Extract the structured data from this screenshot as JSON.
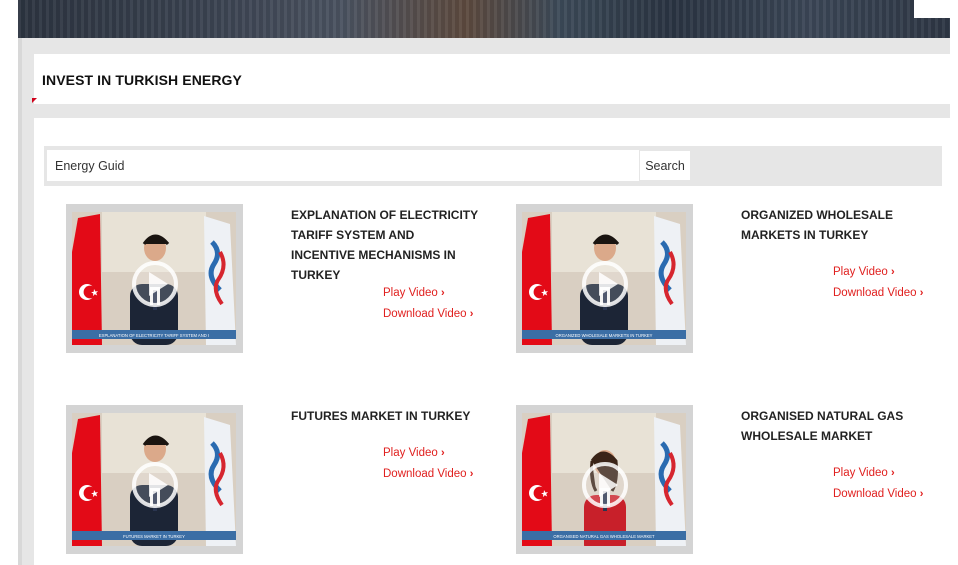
{
  "section": {
    "title": "INVEST IN TURKISH ENERGY"
  },
  "search": {
    "value": "Energy Guid",
    "button_label": "Search"
  },
  "videos": [
    {
      "title": "EXPLANATION OF ELECTRICITY TARIFF SYSTEM AND INCENTIVE MECHANISMS IN TURKEY",
      "play_label": "Play Video",
      "download_label": "Download Video",
      "caption": "EXPLANATION OF ELECTRICITY TARIFF SYSTEM AND INCENTIVE MECHANISMS IN TURKEY",
      "presenter": "man"
    },
    {
      "title": "ORGANIZED WHOLESALE MARKETS IN TURKEY",
      "play_label": "Play Video",
      "download_label": "Download Video",
      "caption": "ORGANIZED WHOLESALE MARKETS IN TURKEY",
      "presenter": "man"
    },
    {
      "title": "FUTURES MARKET IN TURKEY",
      "play_label": "Play Video",
      "download_label": "Download Video",
      "caption": "FUTURES MARKET IN TURKEY",
      "presenter": "man"
    },
    {
      "title": "ORGANISED NATURAL GAS WHOLESALE MARKET",
      "play_label": "Play Video",
      "download_label": "Download Video",
      "caption": "ORGANISED NATURAL GAS WHOLESALE MARKET",
      "presenter": "woman"
    }
  ],
  "icons": {
    "play": "play-circle-icon",
    "chevron": "chevron-right-icon",
    "flag": "turkish-flag-icon"
  },
  "colors": {
    "link": "#e0201f",
    "flag_red": "#e30a17",
    "caption_bar": "#3b6ea5",
    "panel_gray": "#e6e6e6"
  }
}
